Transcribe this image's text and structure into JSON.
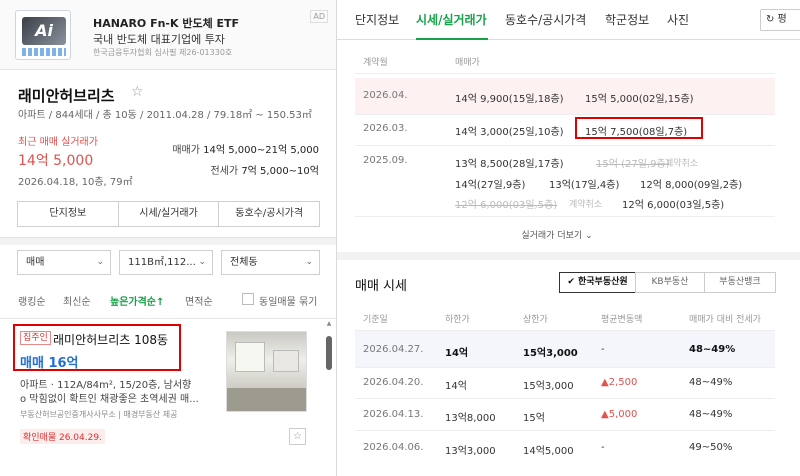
{
  "ad": {
    "title": "HANARO Fn-K 반도체 ETF",
    "subtitle": "국내 반도체 대표기업에 투자",
    "note": "한국금융투자협회 심사필 제26-01330호",
    "badge": "AD"
  },
  "complex": {
    "name": "래미안허브리츠",
    "meta": "아파트 / 844세대 / 총 10동 / 2011.04.28 / 79.18㎡ ~ 150.53㎡",
    "recent_label": "최근 매매 실거래가",
    "recent_price": "14억 5,000",
    "recent_detail": "2026.04.18, 10층, 79㎡",
    "sale_range_label": "매매가",
    "sale_range": "14억 5,000~21억 5,000",
    "lease_range_label": "전세가",
    "lease_range": "7억 5,000~10억"
  },
  "left_tabs": [
    "단지정보",
    "시세/실거래가",
    "동호수/공시가격"
  ],
  "filters": {
    "trade_type": "매매",
    "area": "111B㎡,112...",
    "dong": "전체동"
  },
  "sort": {
    "options": [
      "랭킹순",
      "최신순",
      "높은가격순↑",
      "면적순"
    ],
    "active_index": 2,
    "same_listing": "동일매물 묶기"
  },
  "listing": {
    "tag": "집주인",
    "title": "래미안허브리츠 108동",
    "price": "매매 16억",
    "spec": "아파트 · 112A/84m², 15/20층, 남서향",
    "desc": "o 막힘없이 확트인 채광좋은 초역세권 매...",
    "agent": "부동산허브공인중개사사무소 | 매경부동산 제공",
    "verified": "확인매물 26.04.29."
  },
  "right_tabs": {
    "items": [
      "단지정보",
      "시세/실거래가",
      "동호수/공시가격",
      "학군정보",
      "사진"
    ],
    "active_index": 1,
    "share": "↻ 평"
  },
  "transactions": {
    "headers": [
      "계약월",
      "매매가"
    ],
    "rows": [
      {
        "month": "2026.04.",
        "lines": [
          [
            {
              "text": "14억 9,900(15일,18층)",
              "status": "normal"
            },
            {
              "text": "15억 5,000(02일,15층)",
              "status": "normal"
            }
          ]
        ]
      },
      {
        "month": "2026.03.",
        "lines": [
          [
            {
              "text": "14억 3,000(25일,10층)",
              "status": "normal"
            },
            {
              "text": "15억 7,500(08일,7층)",
              "status": "normal"
            }
          ]
        ]
      },
      {
        "month": "2025.09.",
        "lines": [
          [
            {
              "text": "13억 8,500(28일,17층)",
              "status": "normal"
            },
            {
              "text": "15억 (27일,9층)",
              "status": "cancelled",
              "note": "계약취소"
            }
          ],
          [
            {
              "text": "14억(27일,9층)",
              "status": "normal"
            },
            {
              "text": "13억(17일,4층)",
              "status": "normal"
            },
            {
              "text": "12억 8,000(09일,2층)",
              "status": "normal"
            }
          ],
          [
            {
              "text": "12억 6,000(03일,5층)",
              "status": "cancelled",
              "note": "계약취소"
            },
            {
              "text": "12억 6,000(03일,5층)",
              "status": "normal"
            }
          ]
        ]
      }
    ],
    "more": "실거래가 더보기"
  },
  "market": {
    "title": "매매 시세",
    "sources": [
      "✔ 한국부동산원",
      "KB부동산",
      "부동산뱅크"
    ],
    "active_source": 0,
    "headers": [
      "기준일",
      "하한가",
      "상한가",
      "평균변동액",
      "매매가 대비 전세가"
    ],
    "rows": [
      {
        "date": "2026.04.27.",
        "low": "14억",
        "high": "15억3,000",
        "change": "-",
        "change_dir": "none",
        "ratio": "48~49%"
      },
      {
        "date": "2026.04.20.",
        "low": "14억",
        "high": "15억3,000",
        "change": "2,500",
        "change_dir": "up",
        "ratio": "48~49%"
      },
      {
        "date": "2026.04.13.",
        "low": "13억8,000",
        "high": "15억",
        "change": "5,000",
        "change_dir": "up",
        "ratio": "48~49%"
      },
      {
        "date": "2026.04.06.",
        "low": "13억3,000",
        "high": "14억5,000",
        "change": "-",
        "change_dir": "none",
        "ratio": "49~50%"
      }
    ]
  },
  "colors": {
    "accent_green": "#16a34a",
    "price_red": "#e0524f",
    "price_blue": "#1f6fd6",
    "highlight": "#e00000"
  }
}
